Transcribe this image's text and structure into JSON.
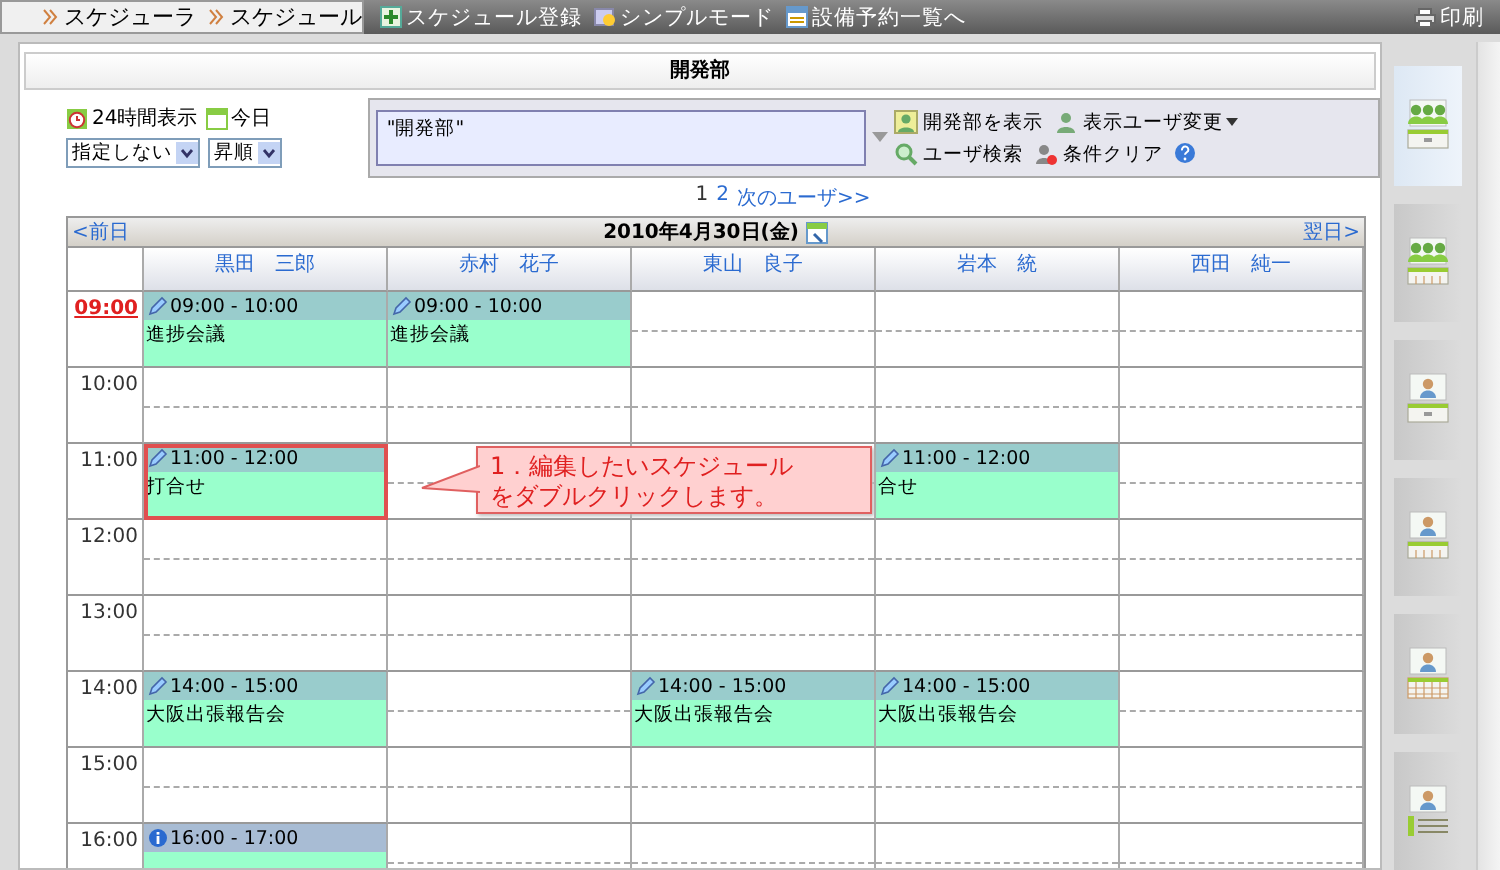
{
  "top_bar": {
    "breadcrumb": [
      "スケジューラ",
      "スケジュール"
    ],
    "menu": [
      {
        "label": "スケジュール登録",
        "kind": "add"
      },
      {
        "label": "シンプルモード",
        "kind": "simple"
      },
      {
        "label": "設備予約一覧へ",
        "kind": "facility"
      }
    ],
    "print": "印刷"
  },
  "panel": {
    "title": "開発部"
  },
  "toolbar": {
    "toggle_24h": "24時間表示",
    "today": "今日",
    "selects": [
      "指定しない",
      "昇順"
    ],
    "search": {
      "value": "\"開発部\""
    },
    "buttons": [
      {
        "label": "開発部を表示",
        "kind": "group"
      },
      {
        "label": "表示ユーザ変更",
        "kind": "menu"
      },
      {
        "label": "ユーザ検索",
        "kind": "search"
      },
      {
        "label": "条件クリア",
        "kind": "clear"
      }
    ]
  },
  "pager": {
    "pages": [
      {
        "label": "1",
        "selected": true
      },
      {
        "label": "2",
        "selected": false
      }
    ],
    "next": "次のユーザ>>"
  },
  "calendar": {
    "prev": "<前日",
    "date": "2010年4月30日(金)",
    "next": "翌日>",
    "columns": [
      "黒田　三郎",
      "赤村　花子",
      "東山　良子",
      "岩本　統",
      "西田　純一"
    ],
    "rows": [
      {
        "time": "09:00",
        "current": true,
        "cells": [
          {
            "kind": "event",
            "time": "09:00 - 10:00",
            "title": "進捗会議",
            "selected": false
          },
          {
            "kind": "event",
            "time": "09:00 - 10:00",
            "title": "進捗会議",
            "selected": false
          },
          {
            "kind": "empty"
          },
          {
            "kind": "empty"
          },
          {
            "kind": "empty"
          }
        ]
      },
      {
        "time": "10:00",
        "current": false,
        "cells": [
          {
            "kind": "empty"
          },
          {
            "kind": "empty"
          },
          {
            "kind": "empty"
          },
          {
            "kind": "empty"
          },
          {
            "kind": "empty"
          }
        ]
      },
      {
        "time": "11:00",
        "current": false,
        "cells": [
          {
            "kind": "event",
            "time": "11:00 - 12:00",
            "title": "打合せ",
            "selected": true
          },
          {
            "kind": "empty"
          },
          {
            "kind": "empty"
          },
          {
            "kind": "event",
            "time": "11:00 - 12:00",
            "title": "合せ",
            "selected": false
          },
          {
            "kind": "empty"
          }
        ]
      },
      {
        "time": "12:00",
        "current": false,
        "cells": [
          {
            "kind": "empty"
          },
          {
            "kind": "empty"
          },
          {
            "kind": "empty"
          },
          {
            "kind": "empty"
          },
          {
            "kind": "empty"
          }
        ]
      },
      {
        "time": "13:00",
        "current": false,
        "cells": [
          {
            "kind": "empty"
          },
          {
            "kind": "empty"
          },
          {
            "kind": "empty"
          },
          {
            "kind": "empty"
          },
          {
            "kind": "empty"
          }
        ]
      },
      {
        "time": "14:00",
        "current": false,
        "cells": [
          {
            "kind": "event",
            "time": "14:00 - 15:00",
            "title": "大阪出張報告会",
            "selected": false
          },
          {
            "kind": "empty"
          },
          {
            "kind": "event",
            "time": "14:00 - 15:00",
            "title": "大阪出張報告会",
            "selected": false
          },
          {
            "kind": "event",
            "time": "14:00 - 15:00",
            "title": "大阪出張報告会",
            "selected": false
          },
          {
            "kind": "empty"
          }
        ]
      },
      {
        "time": "15:00",
        "current": false,
        "cells": [
          {
            "kind": "empty"
          },
          {
            "kind": "empty"
          },
          {
            "kind": "empty"
          },
          {
            "kind": "empty"
          },
          {
            "kind": "empty"
          }
        ]
      },
      {
        "time": "16:00",
        "current": false,
        "cells": [
          {
            "kind": "info_event",
            "time": "16:00 - 17:00",
            "selected": false
          },
          {
            "kind": "empty"
          },
          {
            "kind": "empty"
          },
          {
            "kind": "empty"
          },
          {
            "kind": "empty"
          }
        ]
      }
    ]
  },
  "callout": {
    "lines": [
      "1．編集したいスケジュール",
      "をダブルクリックします。"
    ]
  },
  "view_tabs": [
    {
      "kind": "group_day",
      "selected": true
    },
    {
      "kind": "group_week",
      "selected": false
    },
    {
      "kind": "user_day",
      "selected": false
    },
    {
      "kind": "user_week",
      "selected": false
    },
    {
      "kind": "user_month",
      "selected": false
    },
    {
      "kind": "user_list",
      "selected": false
    }
  ]
}
